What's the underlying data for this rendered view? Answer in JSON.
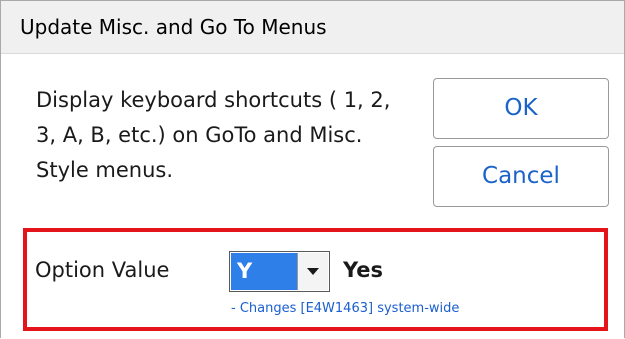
{
  "window": {
    "title": "Update Misc. and Go To Menus"
  },
  "description": {
    "text": "Display keyboard shortcuts ( 1, 2, 3, A, B, etc.) on GoTo and Misc. Style menus."
  },
  "buttons": {
    "ok_label": "OK",
    "cancel_label": "Cancel"
  },
  "option": {
    "label": "Option Value",
    "selected_value": "Y",
    "value_text": "Yes",
    "note": "- Changes [E4W1463] system-wide"
  },
  "colors": {
    "highlight_border": "#e3141a",
    "button_text": "#1a63c8",
    "selected_background": "#2f7fe8",
    "note_text": "#1a5fd0"
  },
  "icons": {
    "dropdown": "chevron-down-icon"
  }
}
